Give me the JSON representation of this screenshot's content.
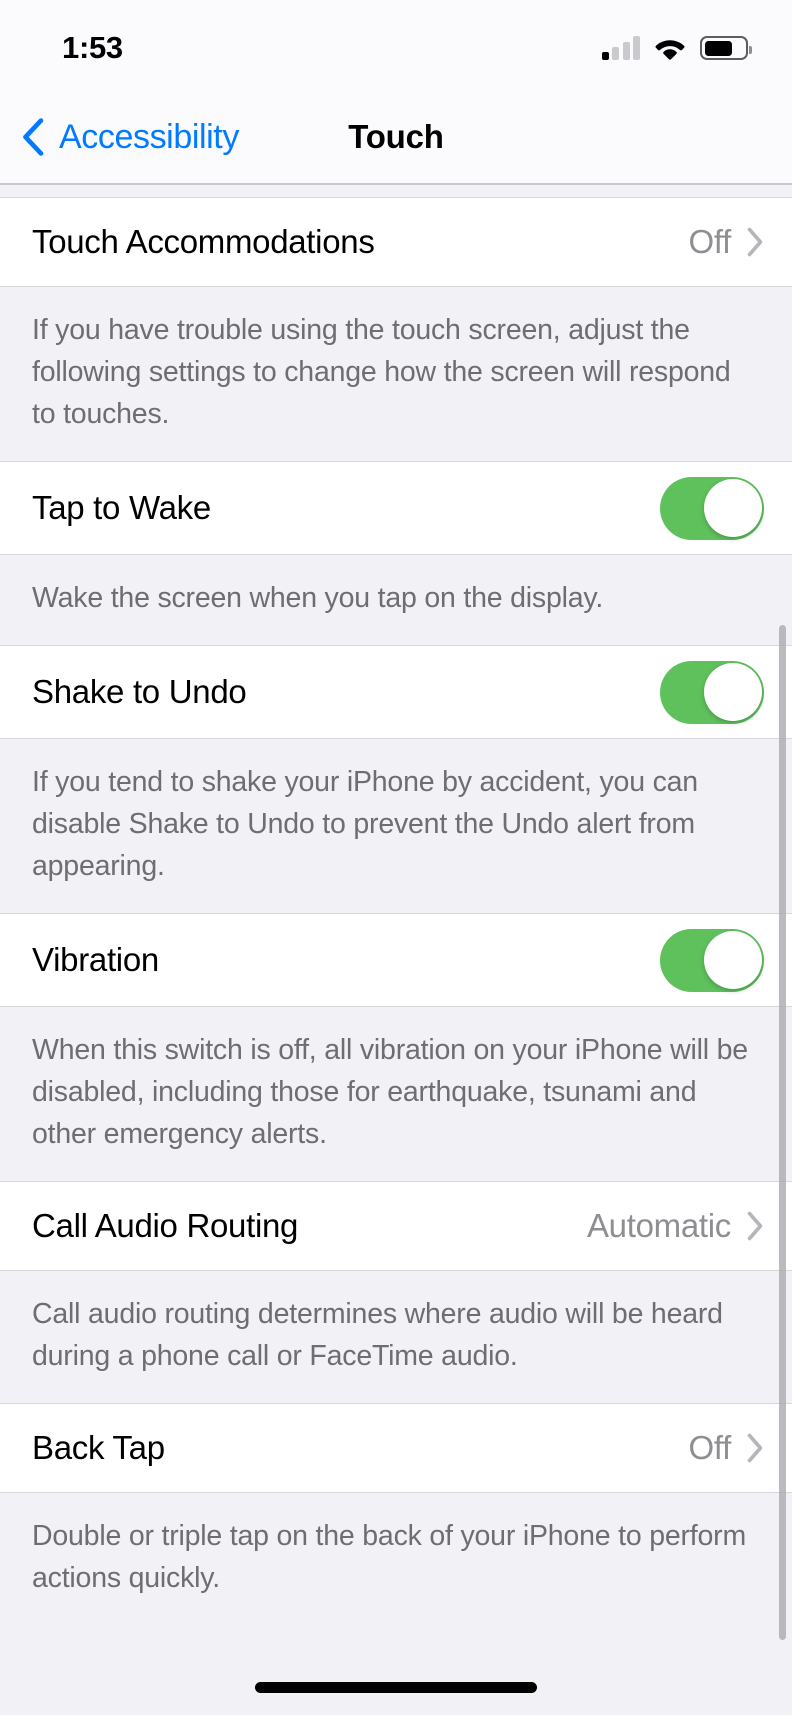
{
  "status_bar": {
    "time": "1:53",
    "signal_icon": "cellular-signal-icon",
    "signal_bars_total": 4,
    "signal_bars_filled": 1,
    "wifi_icon": "wifi-icon",
    "battery_icon": "battery-icon",
    "battery_level_percent": 70
  },
  "nav": {
    "back_label": "Accessibility",
    "back_icon": "chevron-left-icon",
    "title": "Touch"
  },
  "colors": {
    "accent_blue": "#007AFF",
    "toggle_on_green": "#5EC15C",
    "group_background": "#F2F1F6",
    "cell_background": "#FFFFFF",
    "secondary_text": "#8E8E93",
    "footer_text": "#6D6D72",
    "separator": "#D8D7DC"
  },
  "sections": [
    {
      "type": "disclosure",
      "name": "touch-accommodations",
      "label": "Touch Accommodations",
      "value": "Off",
      "chevron_icon": "chevron-right-icon",
      "footer": "If you have trouble using the touch screen, adjust the following settings to change how the screen will respond to touches."
    },
    {
      "type": "toggle",
      "name": "tap-to-wake",
      "label": "Tap to Wake",
      "toggle_on": true,
      "footer": "Wake the screen when you tap on the display."
    },
    {
      "type": "toggle",
      "name": "shake-to-undo",
      "label": "Shake to Undo",
      "toggle_on": true,
      "footer": "If you tend to shake your iPhone by accident, you can disable Shake to Undo to prevent the Undo alert from appearing."
    },
    {
      "type": "toggle",
      "name": "vibration",
      "label": "Vibration",
      "toggle_on": true,
      "footer": "When this switch is off, all vibration on your iPhone will be disabled, including those for earthquake, tsunami and other emergency alerts."
    },
    {
      "type": "disclosure",
      "name": "call-audio-routing",
      "label": "Call Audio Routing",
      "value": "Automatic",
      "chevron_icon": "chevron-right-icon",
      "footer": "Call audio routing determines where audio will be heard during a phone call or FaceTime audio."
    },
    {
      "type": "disclosure",
      "name": "back-tap",
      "label": "Back Tap",
      "value": "Off",
      "chevron_icon": "chevron-right-icon",
      "footer": "Double or triple tap on the back of your iPhone to perform actions quickly."
    }
  ],
  "scroll_indicator": {
    "name": "vertical-scrollbar"
  },
  "home_indicator": {
    "name": "home-indicator"
  }
}
